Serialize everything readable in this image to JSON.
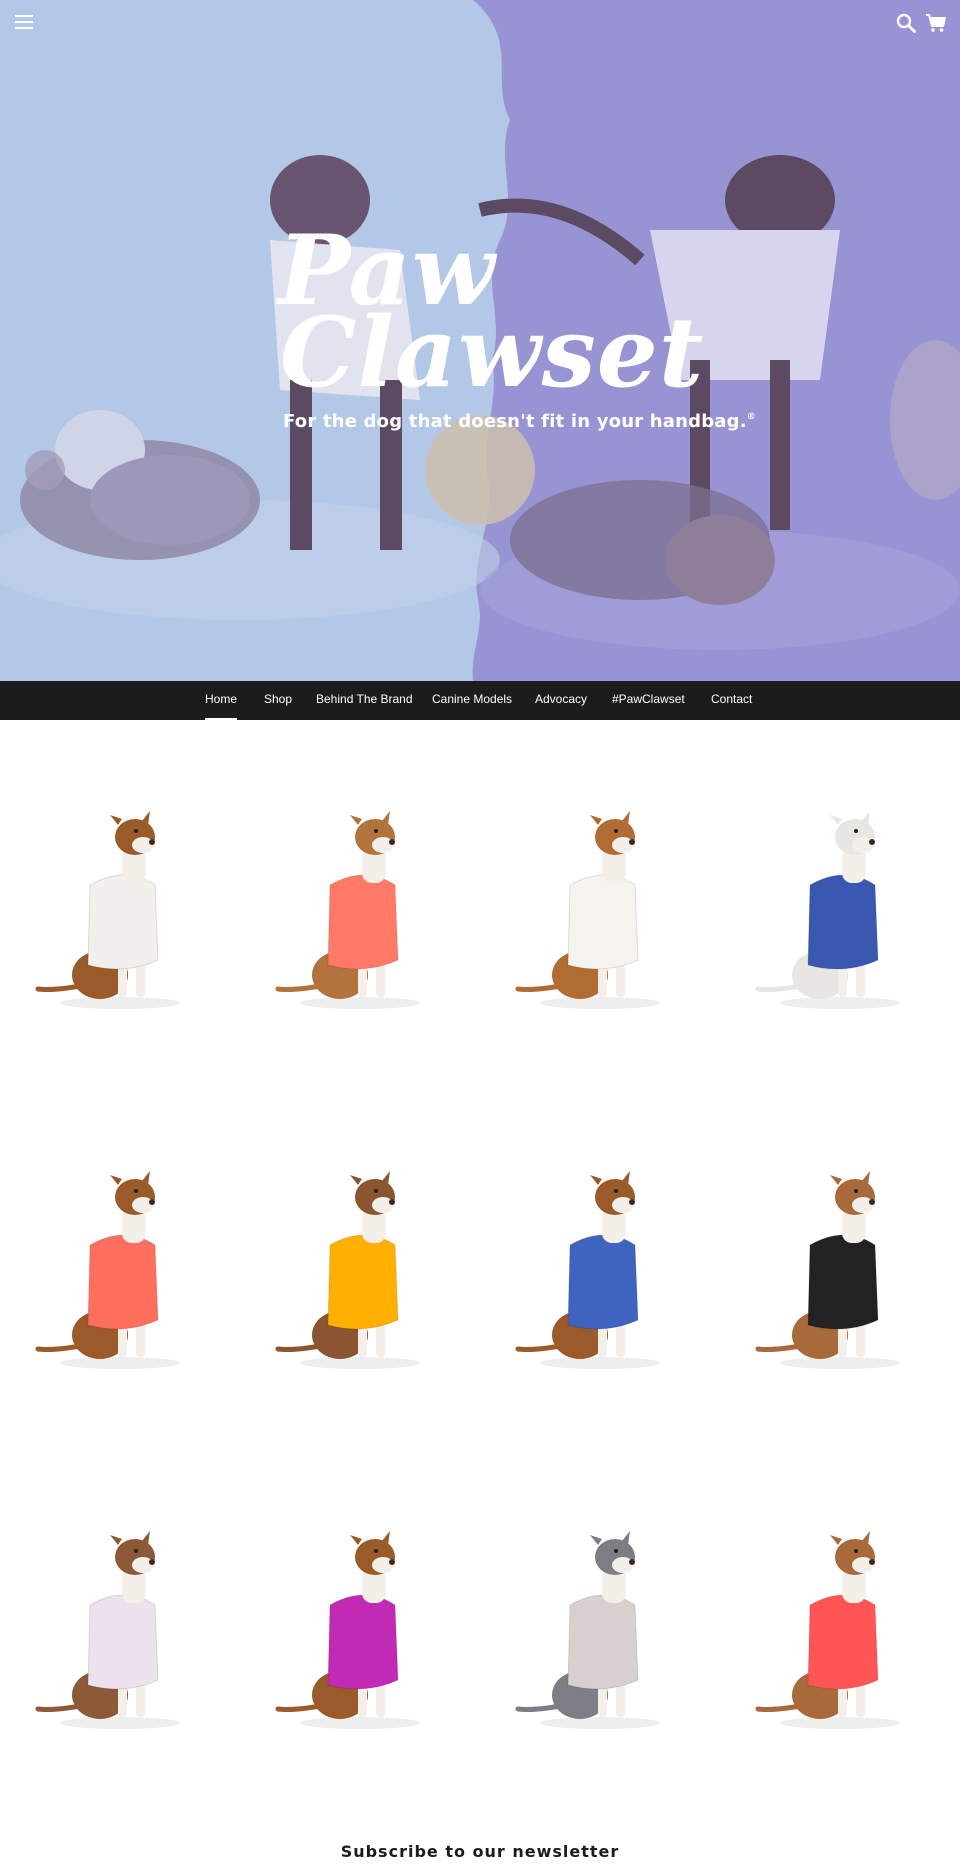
{
  "header": {
    "menu_icon": "hamburger-menu-icon",
    "search_icon": "search-icon",
    "cart_icon": "shopping-cart-icon"
  },
  "hero": {
    "logo_line_1": "Paw",
    "logo_line_2": "Clawset",
    "tagline": "For the dog that doesn't fit in your handbag.",
    "tagline_mark": "®",
    "left_tint": "#b3c8e6",
    "right_tint": "#9893d3"
  },
  "nav": {
    "items": [
      {
        "label": "Home",
        "active": true
      },
      {
        "label": "Shop"
      },
      {
        "label": "Behind The Brand"
      },
      {
        "label": "Canine Models"
      },
      {
        "label": "Advocacy"
      },
      {
        "label": "#PawClawset"
      },
      {
        "label": "Contact"
      }
    ]
  },
  "products": [
    {
      "coat": "#f2f0ec",
      "dog": "#9a5a2a"
    },
    {
      "coat": "#ff7a66",
      "dog": "#b2733d"
    },
    {
      "coat": "#f5f3ee",
      "dog": "#b06c33"
    },
    {
      "coat": "#3a58b0",
      "dog": "#e8e6e2"
    },
    {
      "coat": "#ff6f5e",
      "dog": "#9a5a2a"
    },
    {
      "coat": "#ffb000",
      "dog": "#8a5530"
    },
    {
      "coat": "#3e64c0",
      "dog": "#9a5a2a"
    },
    {
      "coat": "#222222",
      "dog": "#a86a3a"
    },
    {
      "coat": "#ece2ee",
      "dog": "#8c5a38"
    },
    {
      "coat": "#c02ab4",
      "dog": "#9a5a2a"
    },
    {
      "coat": "#d8cfcf",
      "dog": "#7d7d86"
    },
    {
      "coat": "#ff5555",
      "dog": "#a86a3a"
    }
  ],
  "newsletter": {
    "title": "Subscribe to our newsletter"
  }
}
